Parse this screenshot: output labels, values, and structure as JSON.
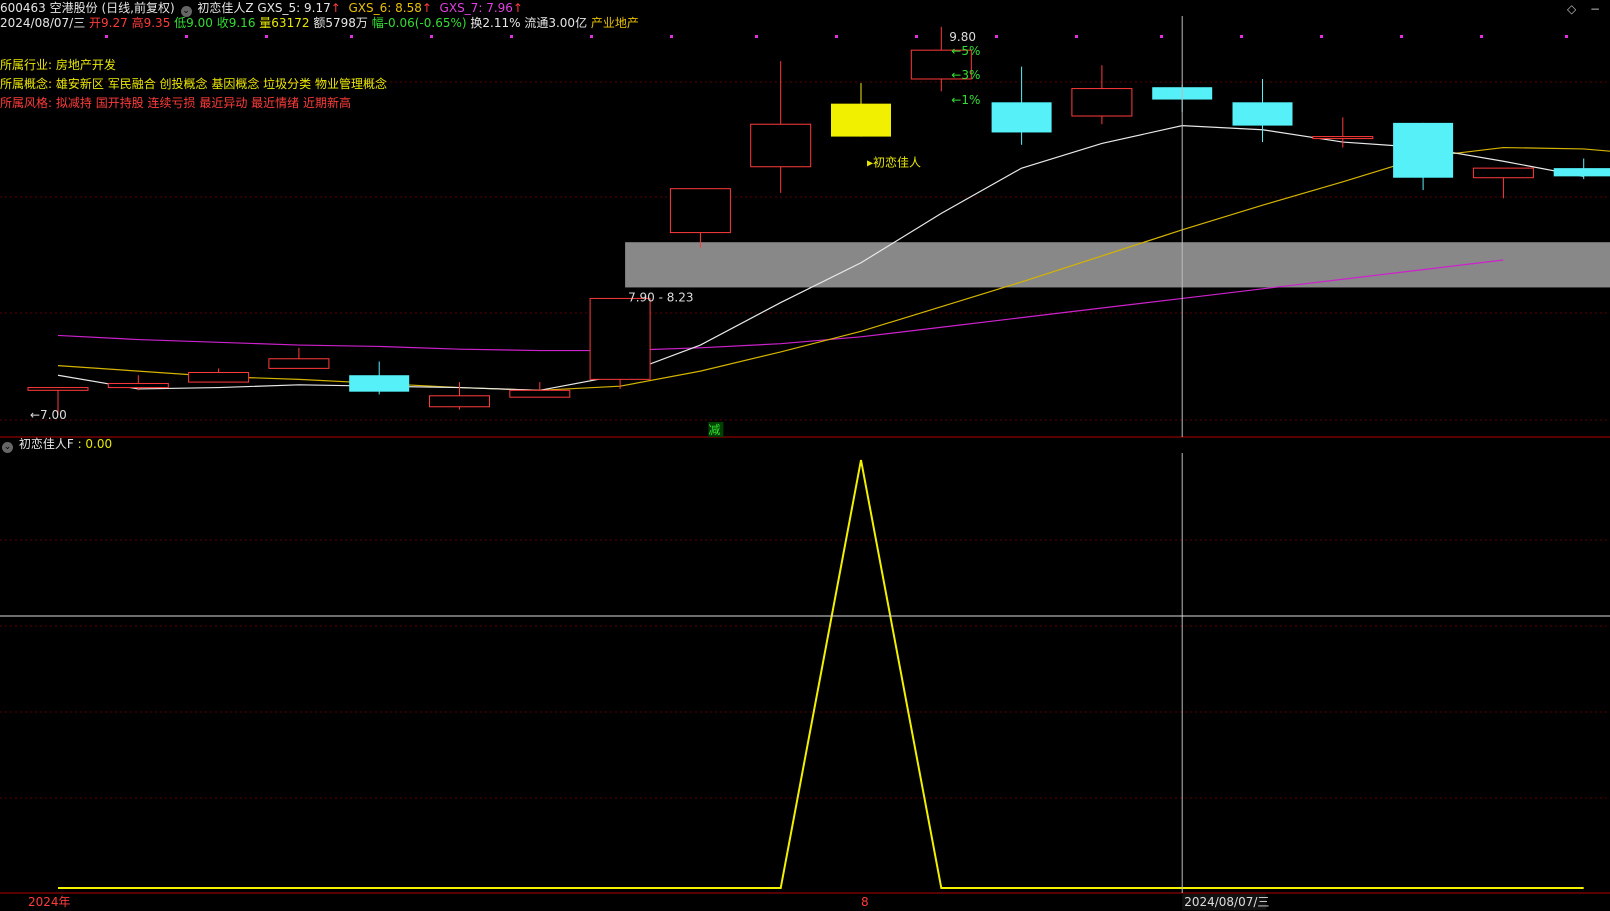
{
  "header": {
    "code": "600463",
    "name": "空港股份",
    "period": "(日线,前复权)",
    "indicator_name": "初恋佳人Z",
    "gxs5_label": "GXS_5:",
    "gxs5_value": "9.17",
    "gxs6_label": "GXS_6:",
    "gxs6_value": "8.58",
    "gxs7_label": "GXS_7:",
    "gxs7_value": "7.96",
    "arrow": "↑",
    "date": "2024/08/07/三",
    "open": "开9.27",
    "high": "高9.35",
    "low": "低9.00",
    "close": "收9.16",
    "volume": "量63172",
    "amount": "额5798万",
    "change": "幅-0.06(-0.65%)",
    "turnover": "换2.11%",
    "float": "流通3.00亿",
    "category": "产业地产"
  },
  "info": {
    "industry_label": "所属行业:",
    "industry": "房地产开发",
    "concept_label": "所属概念:",
    "concepts": "雄安新区 军民融合 创投概念 基因概念 垃圾分类 物业管理概念",
    "style_label": "所属风格:",
    "styles": "拟减持 国开持股 连续亏损 最近异动 最近情绪 近期新高"
  },
  "sub_panel": {
    "title": "初恋佳人F",
    "value": ": 0.00"
  },
  "annotations": {
    "high_price": "9.80",
    "low_price": "7.00",
    "pct5": "←5%",
    "pct3": "←3%",
    "pct1": "←1%",
    "signal": "初恋佳人",
    "zone": "7.90 - 8.23",
    "reduce": "减"
  },
  "xaxis": {
    "year_label": "2024年",
    "month_label": "8",
    "cursor_label": "2024/08/07/三"
  },
  "colors": {
    "up": "#ff3b3b",
    "down": "#55f0f8",
    "ma5": "#e8e8e8",
    "ma6": "#d4b400",
    "ma7": "#cc22cc",
    "signal_line": "#f0f000",
    "zone": "#888888"
  },
  "chart_data": {
    "type": "candlestick",
    "price_range": [
      6.97,
      9.85
    ],
    "candles": [
      {
        "o": 7.17,
        "c": 7.15,
        "h": 7.17,
        "l": 6.97,
        "dir": "up"
      },
      {
        "o": 7.17,
        "c": 7.2,
        "h": 7.26,
        "l": 7.15,
        "dir": "up"
      },
      {
        "o": 7.21,
        "c": 7.28,
        "h": 7.31,
        "l": 7.21,
        "dir": "up"
      },
      {
        "o": 7.31,
        "c": 7.38,
        "h": 7.46,
        "l": 7.31,
        "dir": "up"
      },
      {
        "o": 7.26,
        "c": 7.14,
        "h": 7.36,
        "l": 7.12,
        "dir": "down"
      },
      {
        "o": 7.03,
        "c": 7.11,
        "h": 7.21,
        "l": 7.01,
        "dir": "up"
      },
      {
        "o": 7.1,
        "c": 7.15,
        "h": 7.21,
        "l": 7.1,
        "dir": "up"
      },
      {
        "o": 7.23,
        "c": 7.82,
        "h": 7.82,
        "l": 7.16,
        "dir": "up"
      },
      {
        "o": 8.3,
        "c": 8.62,
        "h": 8.62,
        "l": 8.19,
        "dir": "up"
      },
      {
        "o": 8.78,
        "c": 9.09,
        "h": 9.55,
        "l": 8.59,
        "dir": "up"
      },
      {
        "o": 9.0,
        "c": 9.24,
        "h": 9.39,
        "l": 9.0,
        "dir": "yellow"
      },
      {
        "o": 9.42,
        "c": 9.63,
        "h": 9.8,
        "l": 9.33,
        "dir": "up"
      },
      {
        "o": 9.25,
        "c": 9.03,
        "h": 9.51,
        "l": 8.94,
        "dir": "down"
      },
      {
        "o": 9.15,
        "c": 9.35,
        "h": 9.52,
        "l": 9.09,
        "dir": "up"
      },
      {
        "o": 9.36,
        "c": 9.27,
        "h": 9.38,
        "l": 9.18,
        "dir": "down"
      },
      {
        "o": 9.25,
        "c": 9.08,
        "h": 9.42,
        "l": 8.96,
        "dir": "down"
      },
      {
        "o": 9.0,
        "c": 9.0,
        "h": 9.14,
        "l": 8.92,
        "dir": "up"
      },
      {
        "o": 9.1,
        "c": 8.7,
        "h": 9.1,
        "l": 8.61,
        "dir": "down"
      },
      {
        "o": 8.7,
        "c": 8.77,
        "h": 8.77,
        "l": 8.55,
        "dir": "up"
      },
      {
        "o": 8.77,
        "c": 8.71,
        "h": 8.84,
        "l": 8.69,
        "dir": "down"
      }
    ],
    "ma5": [
      7.26,
      7.16,
      7.17,
      7.19,
      7.18,
      7.17,
      7.15,
      7.26,
      7.48,
      7.79,
      8.08,
      8.44,
      8.77,
      8.95,
      9.08,
      9.05,
      8.96,
      8.92,
      8.82,
      8.71
    ],
    "ma6": [
      7.33,
      7.29,
      7.25,
      7.23,
      7.2,
      7.17,
      7.15,
      7.18,
      7.29,
      7.43,
      7.58,
      7.76,
      7.94,
      8.13,
      8.32,
      8.5,
      8.67,
      8.85,
      8.92,
      8.91,
      8.86
    ],
    "ma7": [
      7.55,
      7.52,
      7.5,
      7.48,
      7.47,
      7.45,
      7.44,
      7.44,
      7.46,
      7.49,
      7.54,
      7.61,
      7.68,
      7.75,
      7.82,
      7.89,
      7.96,
      8.03,
      8.1
    ],
    "zone": [
      7.9,
      8.23
    ],
    "signal_series": [
      0,
      0,
      0,
      0,
      0,
      0,
      0,
      0,
      0,
      0,
      1,
      0,
      0,
      0,
      0,
      0,
      0,
      0,
      0,
      0
    ],
    "signal_range": [
      0,
      1
    ]
  }
}
